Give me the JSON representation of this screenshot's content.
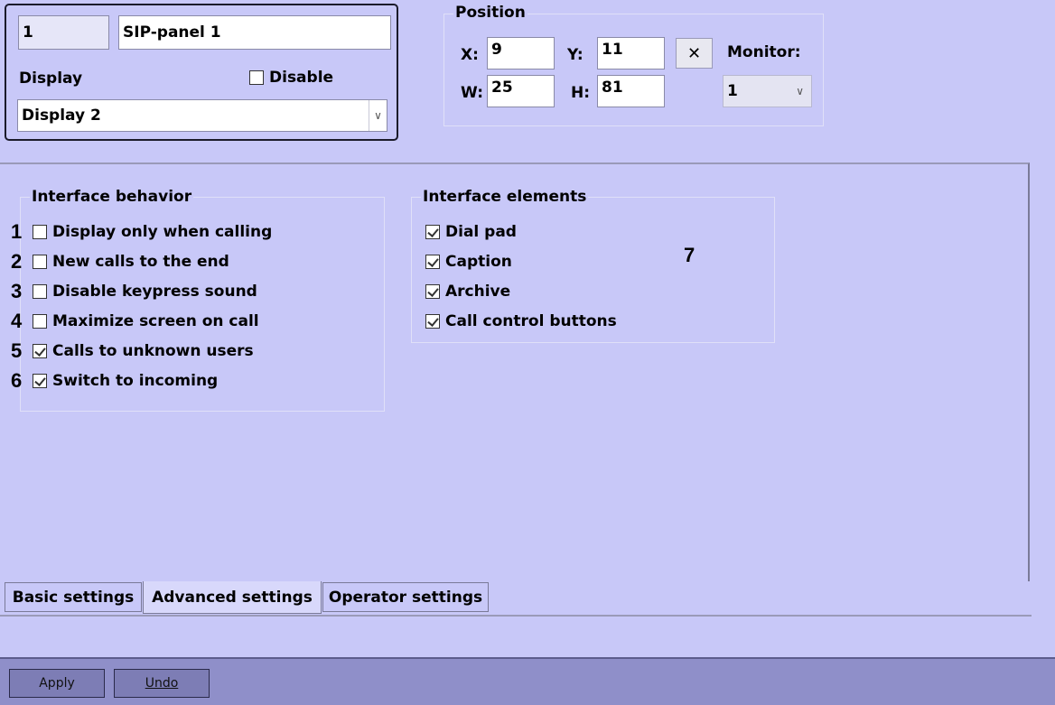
{
  "object": {
    "id_value": "1",
    "name_value": "SIP-panel 1",
    "display_label": "Display",
    "disable_label": "Disable",
    "disable_checked": false,
    "display_select_value": "Display 2"
  },
  "position": {
    "title": "Position",
    "x_label": "X:",
    "x_value": "9",
    "y_label": "Y:",
    "y_value": "11",
    "w_label": "W:",
    "w_value": "25",
    "h_label": "H:",
    "h_value": "81",
    "clear_button": "✕",
    "monitor_label": "Monitor:",
    "monitor_value": "1"
  },
  "interface_behavior": {
    "title": "Interface behavior",
    "items": [
      {
        "num": "1",
        "label": "Display only when calling",
        "checked": false
      },
      {
        "num": "2",
        "label": "New calls to the end",
        "checked": false
      },
      {
        "num": "3",
        "label": "Disable keypress sound",
        "checked": false
      },
      {
        "num": "4",
        "label": "Maximize screen on call",
        "checked": false
      },
      {
        "num": "5",
        "label": "Calls to unknown users",
        "checked": true
      },
      {
        "num": "6",
        "label": "Switch to incoming",
        "checked": true
      }
    ]
  },
  "interface_elements": {
    "title": "Interface elements",
    "marker": "7",
    "items": [
      {
        "label": "Dial pad",
        "checked": true
      },
      {
        "label": "Caption",
        "checked": true
      },
      {
        "label": "Archive",
        "checked": true
      },
      {
        "label": "Call control buttons",
        "checked": true
      }
    ]
  },
  "tabs": [
    {
      "label": "Basic settings",
      "active": false
    },
    {
      "label": "Advanced settings",
      "active": true
    },
    {
      "label": "Operator settings",
      "active": false
    }
  ],
  "buttons": {
    "apply": "Apply",
    "undo": "Undo"
  },
  "icons": {
    "dropdown": "chevron-down-icon",
    "clear": "close-icon"
  }
}
